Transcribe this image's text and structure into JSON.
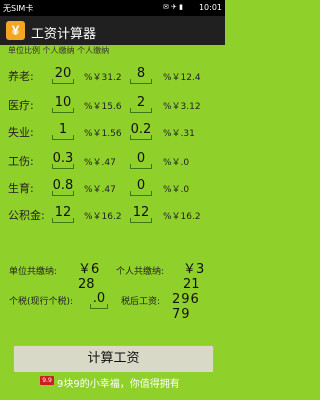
{
  "status_bar": {
    "carrier": "无SIM卡",
    "icons": "✉ ✈ ▮",
    "time": "10:01"
  },
  "app": {
    "icon_glyph": "¥",
    "title": "工资计算器"
  },
  "header_cut_text": "单位比例 个人缴纳   个人缴纳",
  "rows": [
    {
      "label": "养老:",
      "unit_value": "20",
      "unit_amount": "%￥31.2",
      "personal_value": "8",
      "personal_amount": "%￥12.4"
    },
    {
      "label": "医疗:",
      "unit_value": "10",
      "unit_amount": "%￥15.6",
      "personal_value": "2",
      "personal_amount": "%￥3.12"
    },
    {
      "label": "失业:",
      "unit_value": "1",
      "unit_amount": "%￥1.56",
      "personal_value": "0.2",
      "personal_amount": "%￥.31"
    },
    {
      "label": "工伤:",
      "unit_value": "0.3",
      "unit_amount": "%￥.47",
      "personal_value": "0",
      "personal_amount": "%￥.0"
    },
    {
      "label": "生育:",
      "unit_value": "0.8",
      "unit_amount": "%￥.47",
      "personal_value": "0",
      "personal_amount": "%￥.0"
    },
    {
      "label": "公积金:",
      "unit_value": "12",
      "unit_amount": "%￥16.2",
      "personal_value": "12",
      "personal_amount": "%￥16.2"
    }
  ],
  "totals": {
    "unit_label": "单位共缴纳:",
    "unit_value": "￥628",
    "personal_label": "个人共缴纳:",
    "personal_value": "￥321"
  },
  "tax": {
    "label": "个税(现行个税):",
    "value": ".0",
    "after_label": "税后工资:",
    "after_value": "29679"
  },
  "calc_button": "计算工资",
  "ad": {
    "text": "9块9的小幸福，你值得拥有",
    "icon": "9.9"
  }
}
